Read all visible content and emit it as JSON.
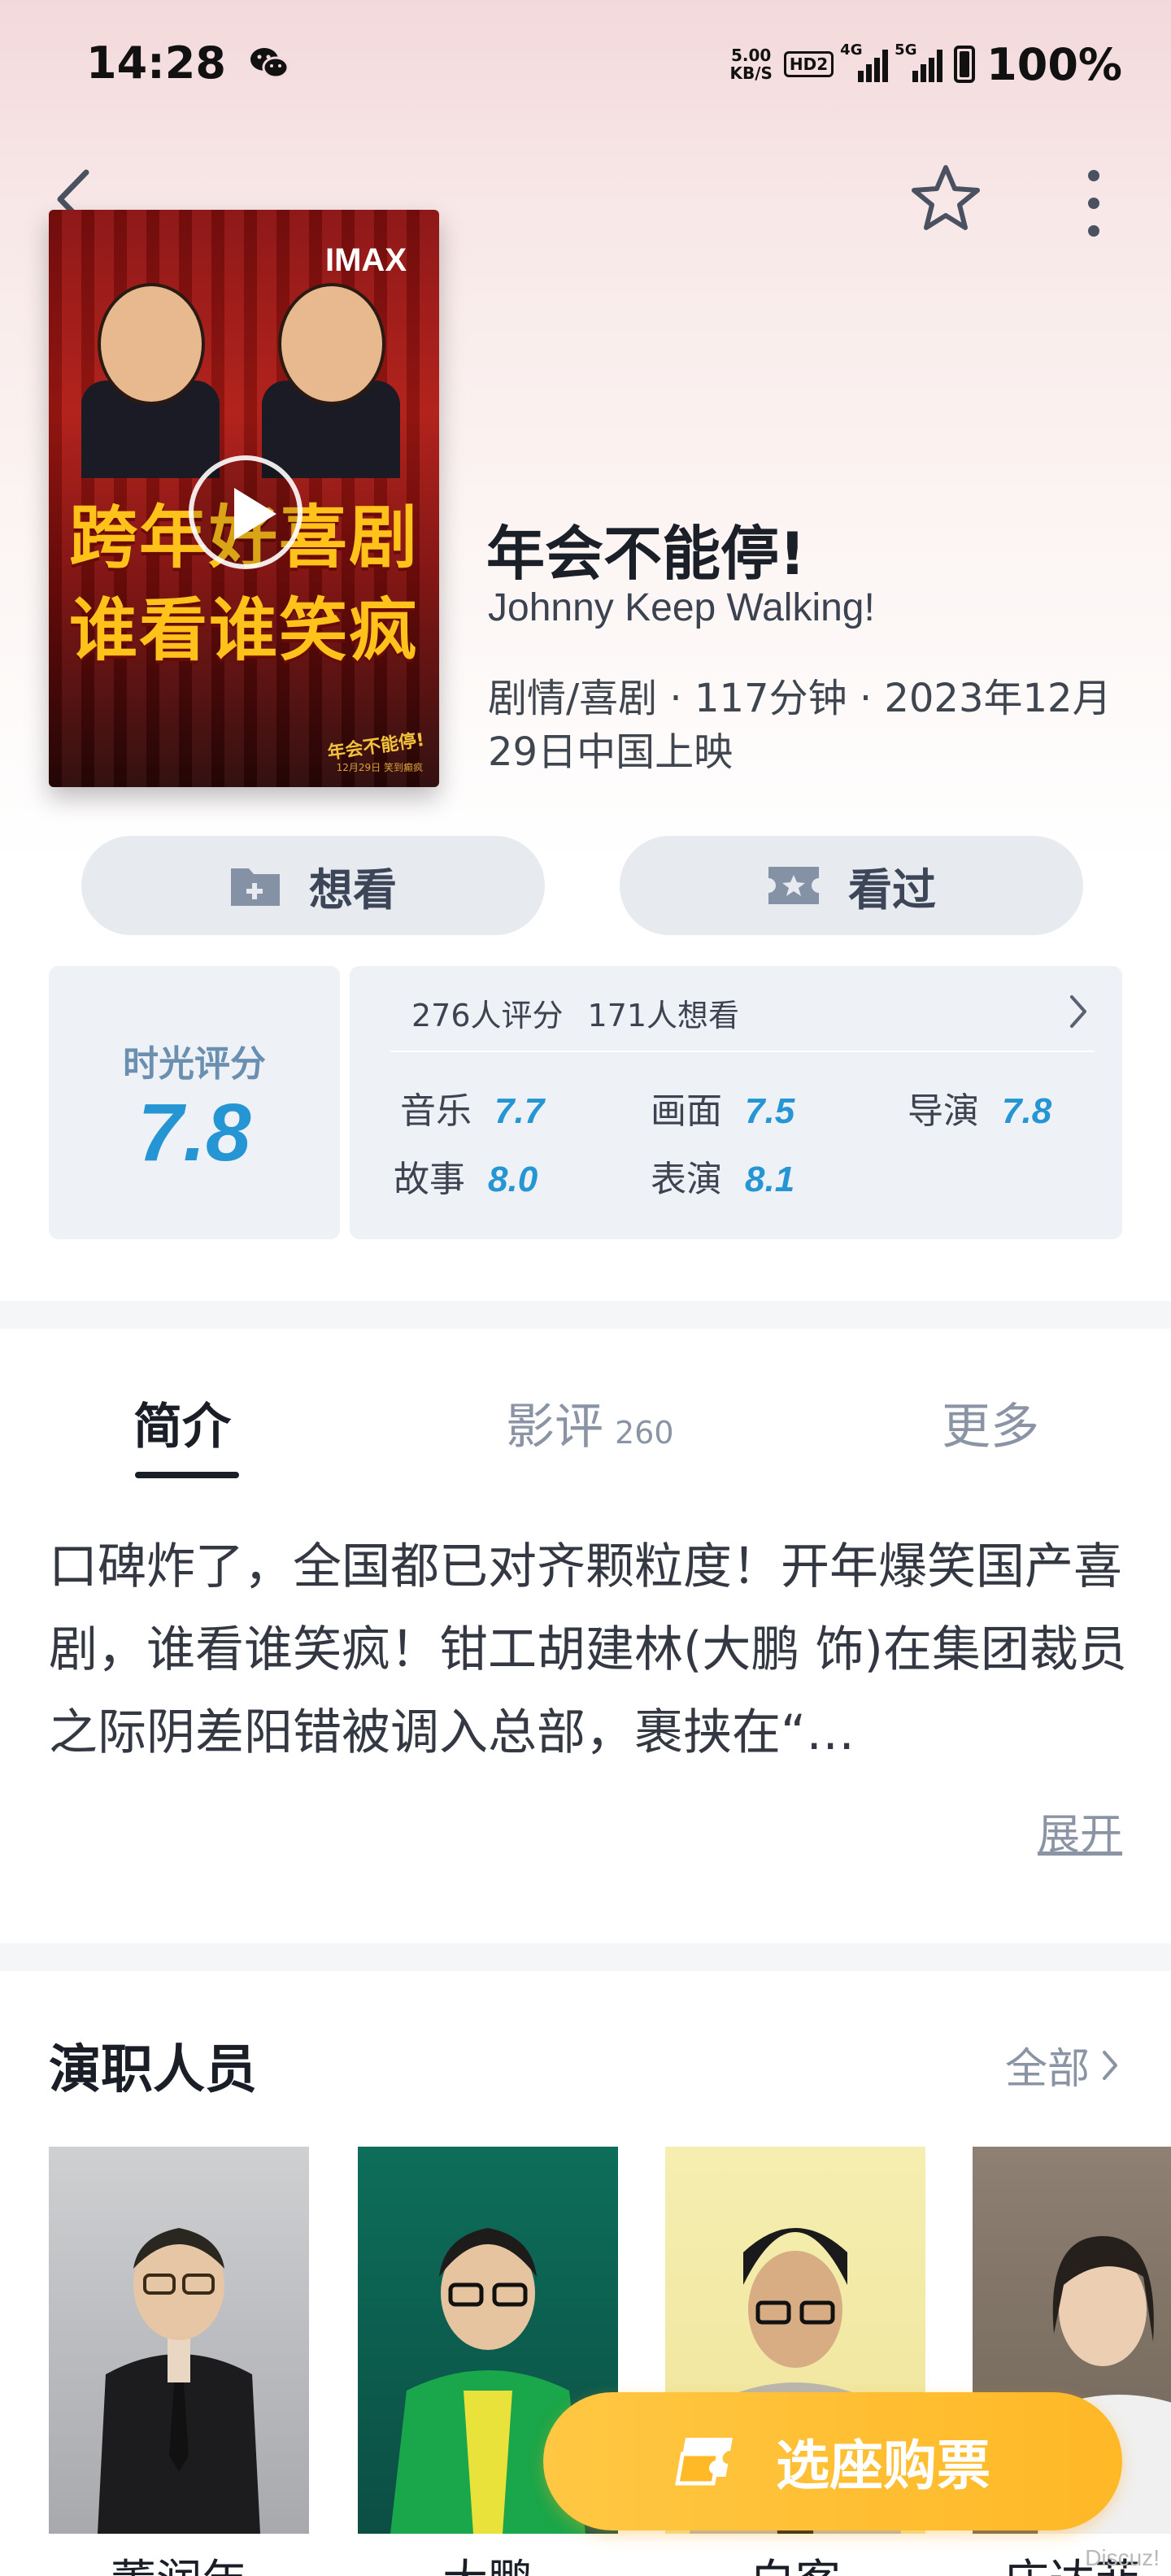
{
  "status_bar": {
    "time": "14:28",
    "net_speed_value": "5.00",
    "net_speed_unit": "KB/S",
    "hd_badge": "HD2",
    "signal1_label": "4G",
    "signal2_label": "5G",
    "battery": "100%"
  },
  "movie": {
    "title": "年会不能停!",
    "title_en": "Johnny Keep Walking!",
    "meta": "剧情/喜剧 · 117分钟 · 2023年12月29日中国上映",
    "poster": {
      "badge": "IMAX",
      "line1": "跨年好喜剧",
      "line2": "谁看谁笑疯",
      "logo": "年会不能停!",
      "logo_sub": "12月29日 笑到癫疯"
    }
  },
  "actions": {
    "want": "想看",
    "watched": "看过"
  },
  "rating": {
    "label": "时光评分",
    "score": "7.8",
    "raters": "276人评分",
    "wishers": "171人想看",
    "subscores": [
      {
        "label": "音乐",
        "value": "7.7"
      },
      {
        "label": "画面",
        "value": "7.5"
      },
      {
        "label": "导演",
        "value": "7.8"
      },
      {
        "label": "故事",
        "value": "8.0"
      },
      {
        "label": "表演",
        "value": "8.1"
      }
    ]
  },
  "tabs": {
    "intro": "简介",
    "reviews": "影评",
    "reviews_count": "260",
    "more": "更多"
  },
  "synopsis": {
    "text": "口碑炸了，全国都已对齐颗粒度！开年爆笑国产喜剧，谁看谁笑疯！钳工胡建林(大鹏 饰)在集团裁员之际阴差阳错被调入总部，裹挟在“…",
    "expand": "展开"
  },
  "cast": {
    "title": "演职人员",
    "all": "全部",
    "members": [
      {
        "name": "董润年"
      },
      {
        "name": "大鹏"
      },
      {
        "name": "白客"
      },
      {
        "name": "庄达菲"
      }
    ]
  },
  "buy": {
    "label": "选座购票"
  },
  "watermark": "Discuz!",
  "colors": {
    "accent_blue": "#2596d3",
    "buy_yellow": "#ffbd30",
    "panel_gray": "#eef1f5"
  }
}
